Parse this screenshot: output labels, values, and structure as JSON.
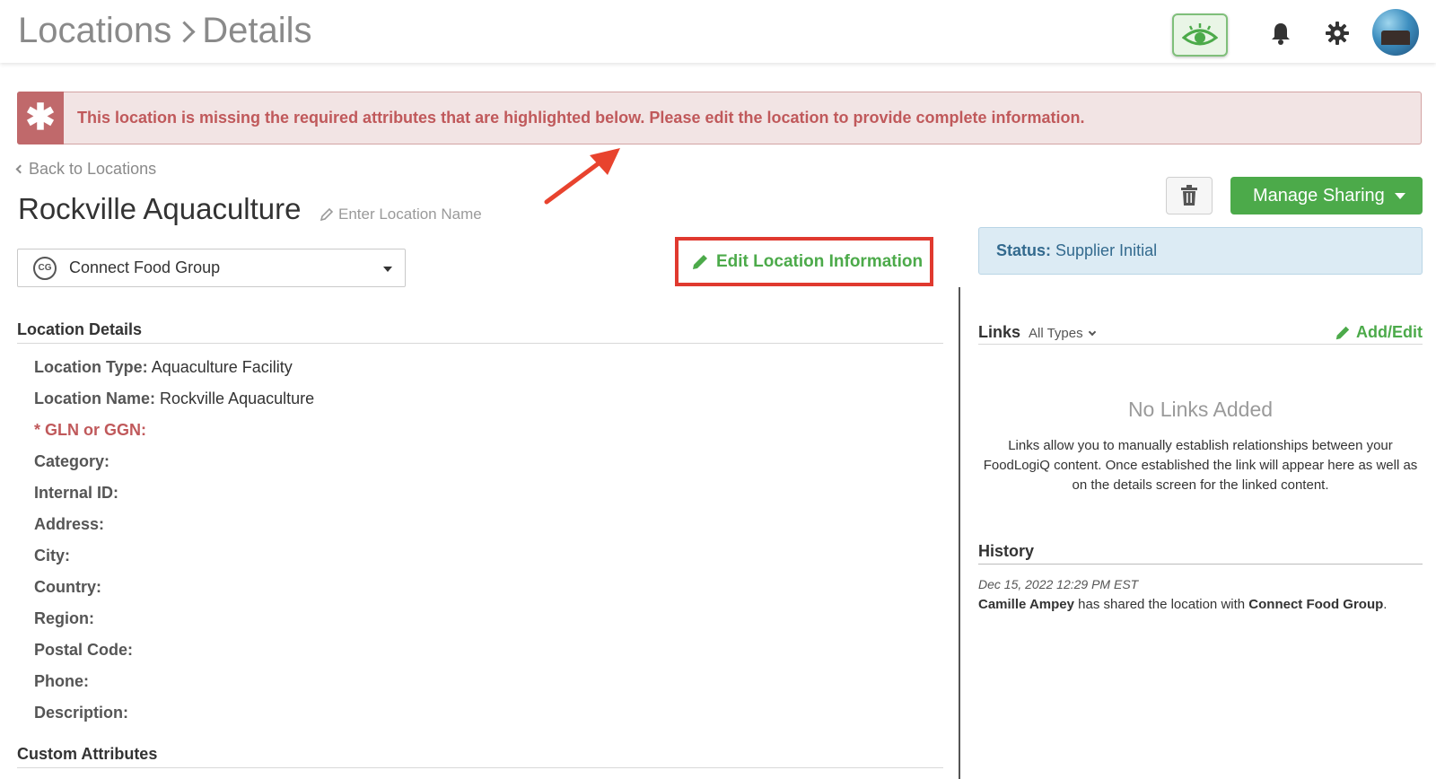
{
  "header": {
    "crumb_locations": "Locations",
    "crumb_details": "Details"
  },
  "alert": {
    "message": "This location is missing the required attributes that are highlighted below. Please edit the location to provide complete information."
  },
  "back_link": "Back to Locations",
  "location": {
    "title": "Rockville Aquaculture",
    "name_hint": "Enter Location Name"
  },
  "toolbar": {
    "manage_sharing": "Manage Sharing",
    "edit_location": "Edit Location Information"
  },
  "org_select": {
    "value": "Connect Food Group"
  },
  "status": {
    "label": "Status:",
    "value": "Supplier Initial"
  },
  "details": {
    "heading": "Location Details",
    "fields": [
      {
        "label": "Location Type:",
        "value": "Aquaculture Facility"
      },
      {
        "label": "Location Name:",
        "value": "Rockville Aquaculture"
      },
      {
        "label": "* GLN or GGN:",
        "value": ""
      },
      {
        "label": "Category:",
        "value": ""
      },
      {
        "label": "Internal ID:",
        "value": ""
      },
      {
        "label": "Address:",
        "value": ""
      },
      {
        "label": "City:",
        "value": ""
      },
      {
        "label": "Country:",
        "value": ""
      },
      {
        "label": "Region:",
        "value": ""
      },
      {
        "label": "Postal Code:",
        "value": ""
      },
      {
        "label": "Phone:",
        "value": ""
      },
      {
        "label": "Description:",
        "value": ""
      }
    ],
    "custom_heading": "Custom Attributes"
  },
  "links": {
    "title": "Links",
    "type_filter": "All Types",
    "add_edit": "Add/Edit",
    "empty_title": "No Links Added",
    "empty_desc": "Links allow you to manually establish relationships between your FoodLogiQ content. Once established the link will appear here as well as on the details screen for the linked content."
  },
  "history": {
    "heading": "History",
    "date": "Dec 15, 2022 12:29 PM EST",
    "actor": "Camille Ampey",
    "action": "has shared the location with",
    "target": "Connect Food Group",
    "period": "."
  },
  "colors": {
    "accent_green": "#4caa4a",
    "alert_red": "#c0595b",
    "status_blue": "#336a8e",
    "highlight_red": "#e0392f"
  }
}
